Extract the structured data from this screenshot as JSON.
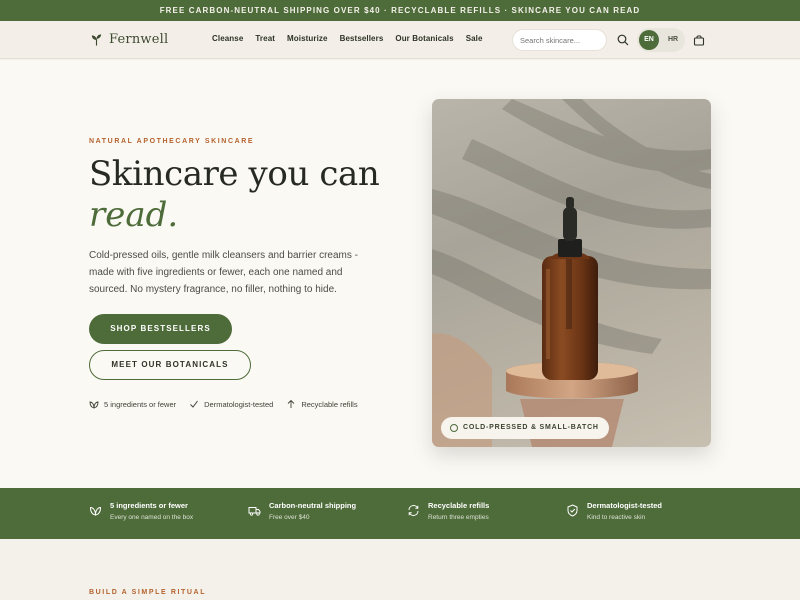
{
  "announcement": "FREE CARBON-NEUTRAL SHIPPING OVER $40 · RECYCLABLE REFILLS · SKINCARE YOU CAN READ",
  "header": {
    "logo": "Fernwell",
    "nav": [
      "Cleanse",
      "Treat",
      "Moisturize",
      "Bestsellers",
      "Our Botanicals",
      "Sale"
    ],
    "search_placeholder": "Search skincare...",
    "lang_active": "EN",
    "lang_other": "HR"
  },
  "hero": {
    "eyebrow": "NATURAL APOTHECARY SKINCARE",
    "title_line1": "Skincare you can",
    "title_line2": "read.",
    "description": "Cold-pressed oils, gentle milk cleansers and barrier creams - made with five ingredients or fewer, each one named and sourced. No mystery fragrance, no filler, nothing to hide.",
    "primary_cta": "SHOP BESTSELLERS",
    "secondary_cta": "MEET OUR BOTANICALS",
    "features": [
      "5 ingredients or fewer",
      "Dermatologist-tested",
      "Recyclable refills"
    ],
    "image_tag": "COLD-PRESSED & SMALL-BATCH"
  },
  "band": [
    {
      "title": "5 ingredients or fewer",
      "sub": "Every one named on the box",
      "icon": "leaf-icon"
    },
    {
      "title": "Carbon-neutral shipping",
      "sub": "Free over $40",
      "icon": "truck-icon"
    },
    {
      "title": "Recyclable refills",
      "sub": "Return three empties",
      "icon": "refresh-icon"
    },
    {
      "title": "Dermatologist-tested",
      "sub": "Kind to reactive skin",
      "icon": "shield-icon"
    }
  ],
  "ritual_eyebrow": "BUILD A SIMPLE RITUAL",
  "colors": {
    "brand_green": "#4e6b3a",
    "accent_rust": "#b5622d",
    "cream": "#fbf9f4"
  }
}
